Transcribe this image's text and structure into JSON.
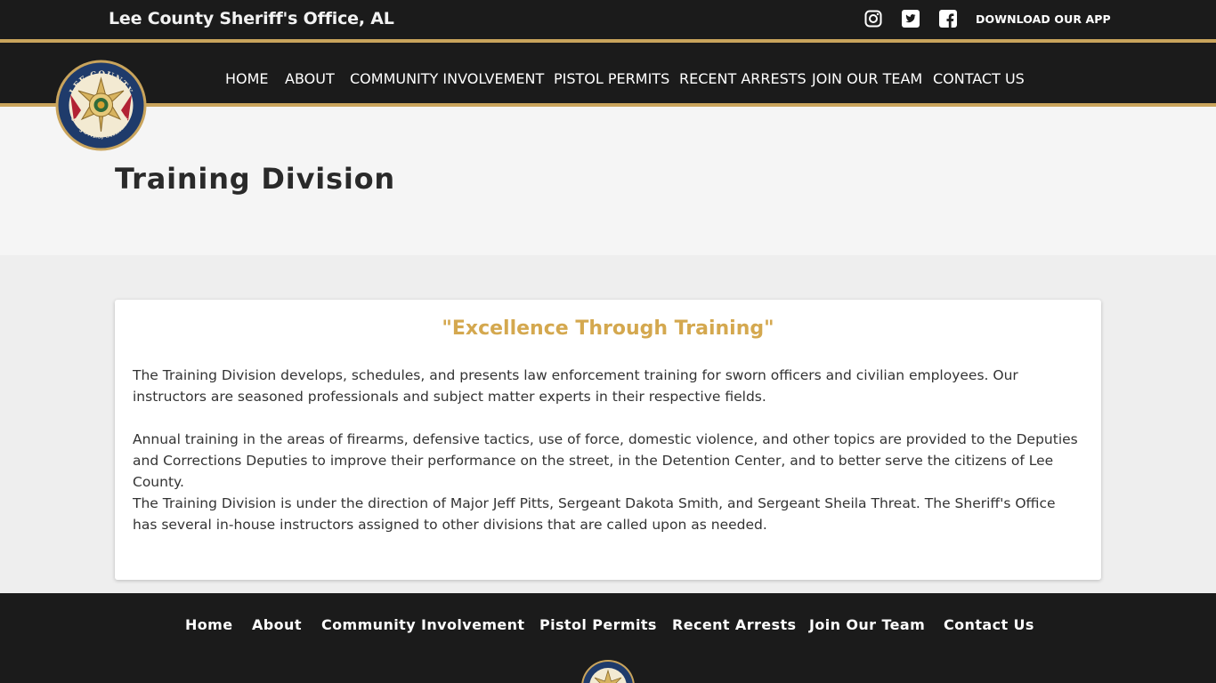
{
  "topbar": {
    "site_title": "Lee County Sheriff's Office, AL",
    "social": [
      {
        "icon": "instagram-icon"
      },
      {
        "icon": "twitter-icon"
      },
      {
        "icon": "facebook-icon"
      }
    ],
    "app_label": "DOWNLOAD OUR APP"
  },
  "nav": {
    "items": [
      "HOME",
      "ABOUT",
      "COMMUNITY INVOLVEMENT",
      "PISTOL PERMITS",
      "RECENT ARRESTS",
      "JOIN OUR TEAM",
      "CONTACT US"
    ]
  },
  "seal": {
    "top_text": "LEE COUNTY",
    "bottom_text": "JAY JONES, SHERIFF",
    "inner_text": "SHERIFF'S OFFICE"
  },
  "page": {
    "title": "Training Division"
  },
  "content": {
    "heading": "\"Excellence Through Training\"",
    "paragraphs": [
      "The Training Division develops, schedules, and presents law enforcement training for sworn officers and civilian employees. Our instructors are seasoned professionals and subject matter experts in their respective fields.",
      "Annual training in the areas of firearms, defensive tactics, use of force, domestic violence, and other topics are provided to the Deputies and Corrections Deputies to improve their performance on the street, in the Detention Center, and to better serve the citizens of Lee County.",
      "The Training Division is under the direction of Major Jeff Pitts, Sergeant Dakota Smith, and Sergeant Sheila Threat. The Sheriff's Office has several in-house instructors assigned to other divisions that are called upon as needed."
    ]
  },
  "footer": {
    "items": [
      "Home",
      "About",
      "Community Involvement",
      "Pistol Permits",
      "Recent Arrests",
      "Join Our Team",
      "Contact Us"
    ]
  },
  "colors": {
    "accent_gold": "#c9a45c",
    "heading_gold": "#d4a84f",
    "bar_dark": "#1b1b1b"
  }
}
